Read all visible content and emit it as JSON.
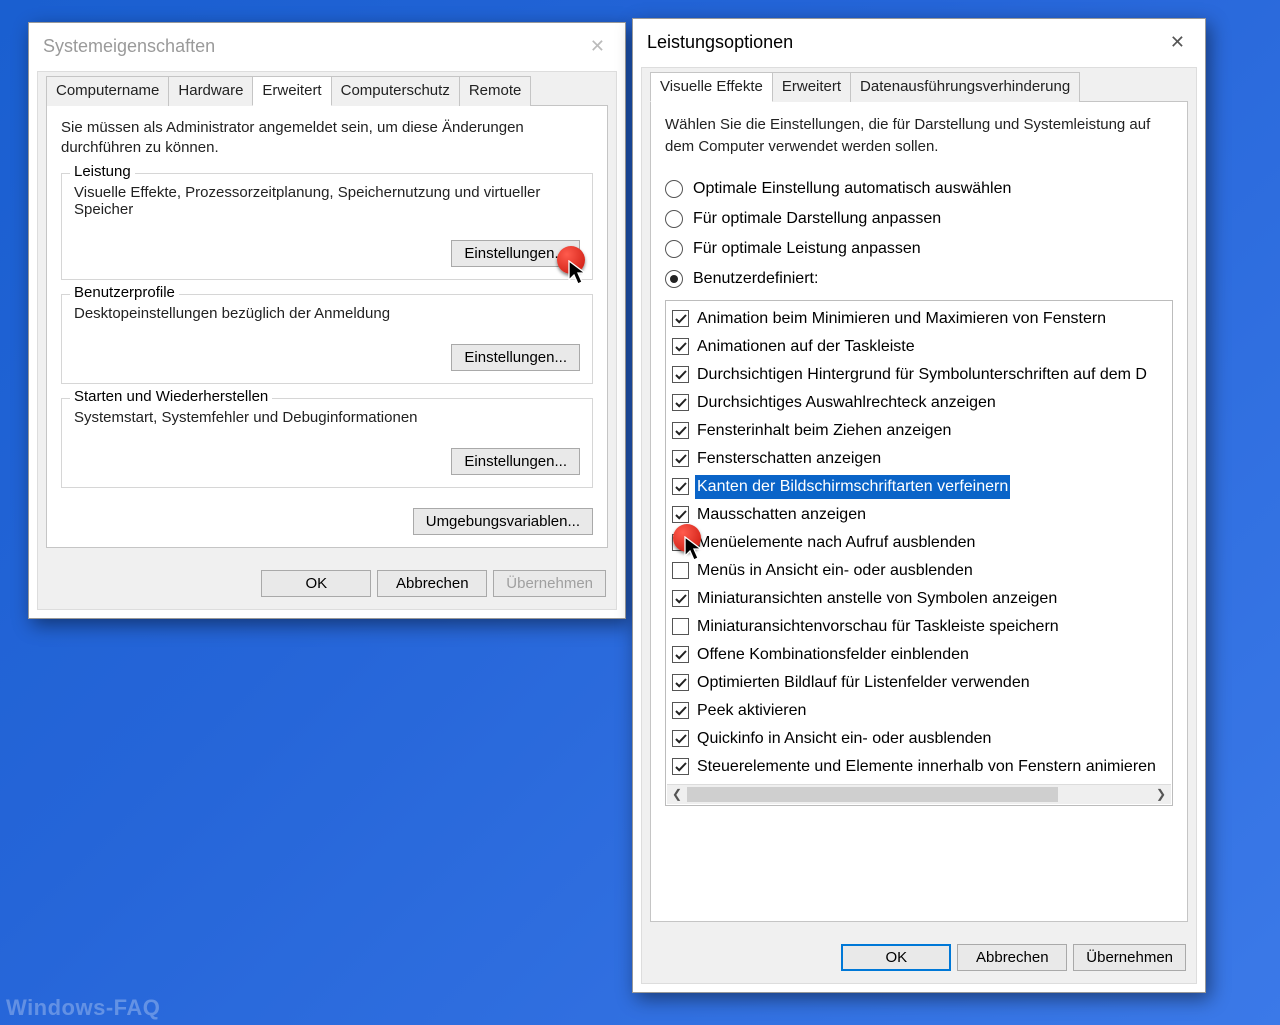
{
  "watermark": "Windows-FAQ",
  "sysprops": {
    "title": "Systemeigenschaften",
    "tabs": [
      "Computername",
      "Hardware",
      "Erweitert",
      "Computerschutz",
      "Remote"
    ],
    "active_tab_index": 2,
    "admin_note": "Sie müssen als Administrator angemeldet sein, um diese Änderungen durchführen zu können.",
    "perf_group": {
      "legend": "Leistung",
      "desc": "Visuelle Effekte, Prozessorzeitplanung, Speichernutzung und virtueller Speicher",
      "button": "Einstellungen..."
    },
    "profiles_group": {
      "legend": "Benutzerprofile",
      "desc": "Desktopeinstellungen bezüglich der Anmeldung",
      "button": "Einstellungen..."
    },
    "startup_group": {
      "legend": "Starten und Wiederherstellen",
      "desc": "Systemstart, Systemfehler und Debuginformationen",
      "button": "Einstellungen..."
    },
    "envvars_button": "Umgebungsvariablen...",
    "ok": "OK",
    "cancel": "Abbrechen",
    "apply": "Übernehmen"
  },
  "perfopts": {
    "title": "Leistungsoptionen",
    "tabs": [
      "Visuelle Effekte",
      "Erweitert",
      "Datenausführungsverhinderung"
    ],
    "active_tab_index": 0,
    "instruction": "Wählen Sie die Einstellungen, die für Darstellung und Systemleistung auf dem Computer verwendet werden sollen.",
    "radios": {
      "auto": {
        "label": "Optimale Einstellung automatisch auswählen",
        "checked": false
      },
      "best_look": {
        "label": "Für optimale Darstellung anpassen",
        "checked": false
      },
      "best_perf": {
        "label": "Für optimale Leistung anpassen",
        "checked": false
      },
      "custom": {
        "label": "Benutzerdefiniert:",
        "checked": true
      }
    },
    "effects": [
      {
        "label": "Animation beim Minimieren und Maximieren von Fenstern",
        "checked": true,
        "selected": false
      },
      {
        "label": "Animationen auf der Taskleiste",
        "checked": true,
        "selected": false
      },
      {
        "label": "Durchsichtigen Hintergrund für Symbolunterschriften auf dem D",
        "checked": true,
        "selected": false
      },
      {
        "label": "Durchsichtiges Auswahlrechteck anzeigen",
        "checked": true,
        "selected": false
      },
      {
        "label": "Fensterinhalt beim Ziehen anzeigen",
        "checked": true,
        "selected": false
      },
      {
        "label": "Fensterschatten anzeigen",
        "checked": true,
        "selected": false
      },
      {
        "label": "Kanten der Bildschirmschriftarten verfeinern",
        "checked": true,
        "selected": true
      },
      {
        "label": "Mausschatten anzeigen",
        "checked": true,
        "selected": false
      },
      {
        "label": "Menüelemente nach Aufruf ausblenden",
        "checked": true,
        "selected": false
      },
      {
        "label": "Menüs in Ansicht ein- oder ausblenden",
        "checked": false,
        "selected": false
      },
      {
        "label": "Miniaturansichten anstelle von Symbolen anzeigen",
        "checked": true,
        "selected": false
      },
      {
        "label": "Miniaturansichtenvorschau für Taskleiste speichern",
        "checked": false,
        "selected": false
      },
      {
        "label": "Offene Kombinationsfelder einblenden",
        "checked": true,
        "selected": false
      },
      {
        "label": "Optimierten Bildlauf für Listenfelder verwenden",
        "checked": true,
        "selected": false
      },
      {
        "label": "Peek aktivieren",
        "checked": true,
        "selected": false
      },
      {
        "label": "Quickinfo in Ansicht ein- oder ausblenden",
        "checked": true,
        "selected": false
      },
      {
        "label": "Steuerelemente und Elemente innerhalb von Fenstern animieren",
        "checked": true,
        "selected": false
      }
    ],
    "ok": "OK",
    "cancel": "Abbrechen",
    "apply": "Übernehmen"
  }
}
